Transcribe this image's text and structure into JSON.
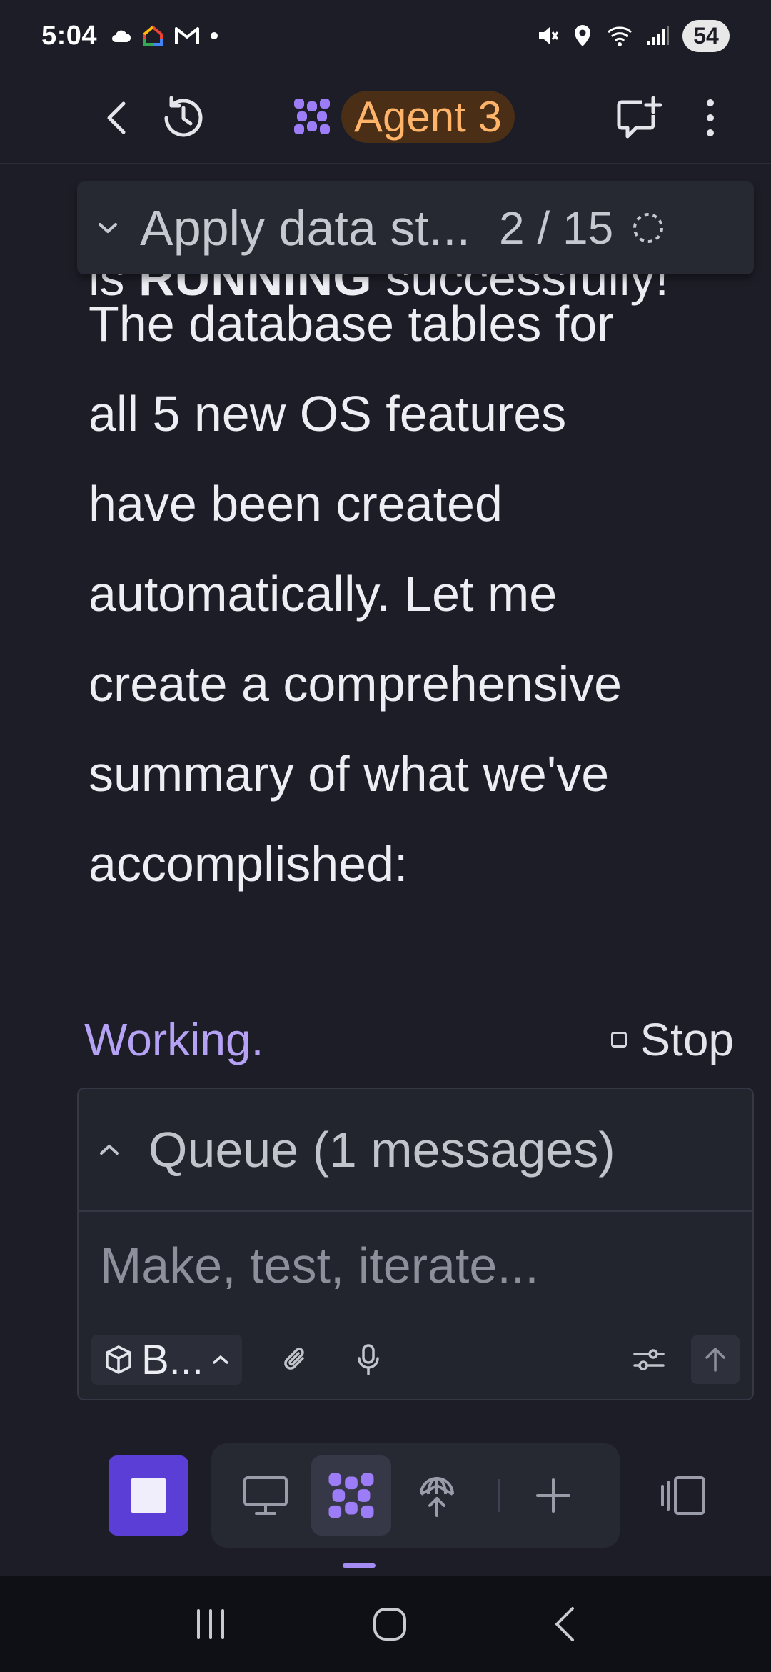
{
  "status_bar": {
    "time": "5:04",
    "battery": "54",
    "left_icons": [
      "cloud-icon",
      "google-home-icon",
      "gmail-icon",
      "dot-icon"
    ],
    "right_icons": [
      "mute-icon",
      "location-icon",
      "wifi-icon",
      "signal-icon"
    ]
  },
  "header": {
    "agent_title": "Agent 3",
    "accent_color": "#ffb46a",
    "pill_color": "#4a2e16"
  },
  "step_card": {
    "title": "Apply data st...",
    "progress": "2 / 15"
  },
  "message": {
    "partial_line": "is RUNNING successfully!",
    "partial_bold": "RUNNING",
    "partial_prefix": "is ",
    "partial_suffix": " successfully!",
    "lines": [
      "The database tables for",
      "all 5 new OS features",
      "have been created",
      "automatically. Let me",
      "create a comprehensive",
      "summary of what we've",
      "accomplished:"
    ]
  },
  "status": {
    "working_label": "Working.",
    "stop_label": "Stop"
  },
  "composer": {
    "queue_label": "Queue (1 messages)",
    "placeholder": "Make, test, iterate...",
    "model_chip_label": "B..."
  },
  "colors": {
    "background": "#1c1d26",
    "working": "#b5a2f5",
    "stop_button": "#5b3ed6"
  }
}
